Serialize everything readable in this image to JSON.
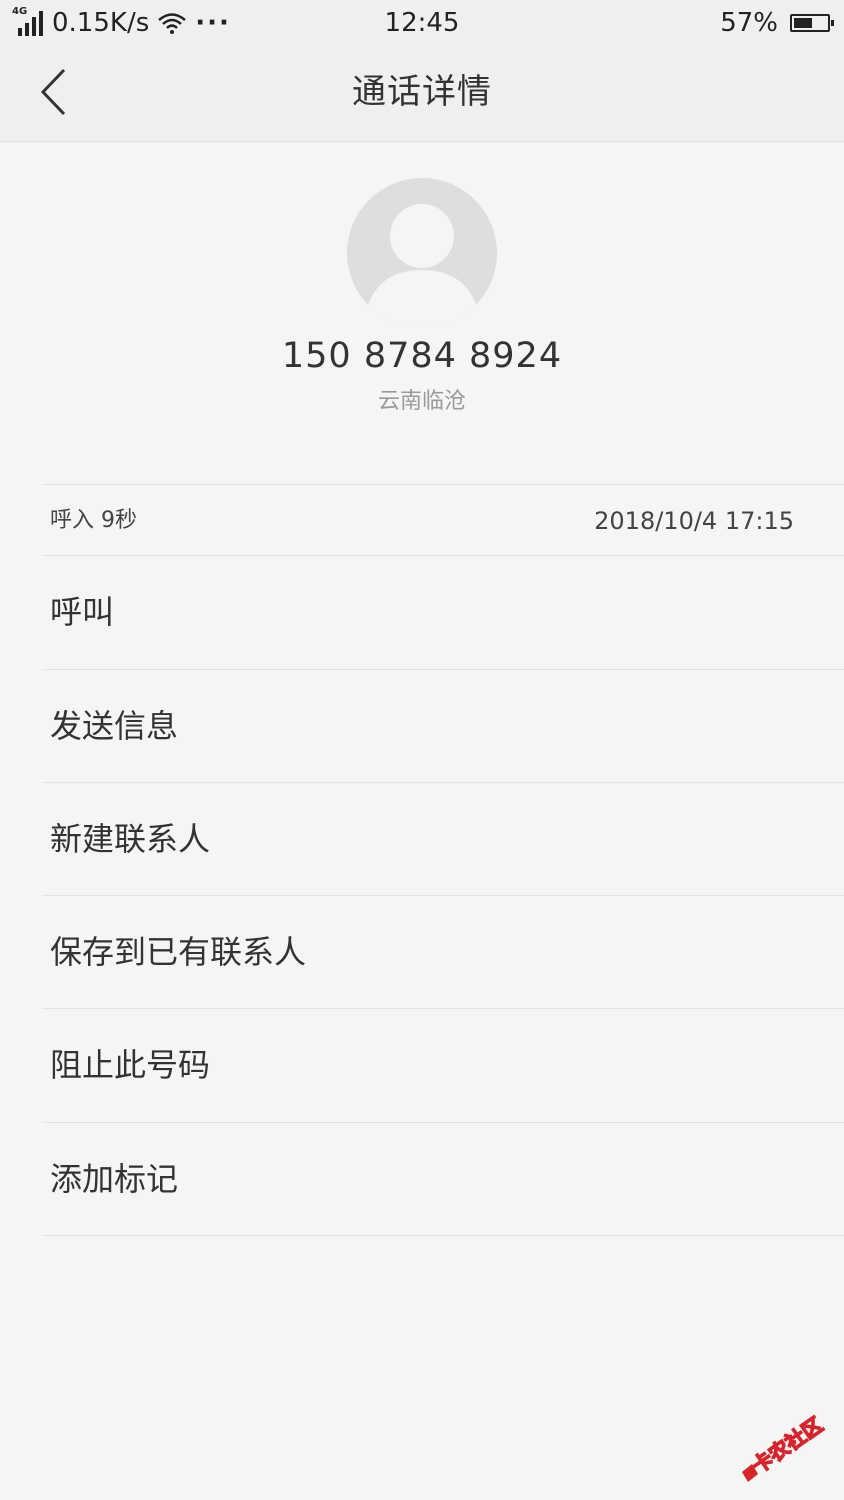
{
  "status_bar": {
    "network_type": "4G",
    "speed": "0.15K/s",
    "more": "···",
    "time": "12:45",
    "battery_percent": "57%",
    "battery_level": 0.57,
    "icons": [
      "signal-icon",
      "wifi-icon",
      "battery-icon"
    ]
  },
  "nav": {
    "title": "通话详情",
    "back_icon": "chevron-left-icon"
  },
  "contact": {
    "avatar_icon": "default-avatar-icon",
    "number": "150 8784 8924",
    "location": "云南临沧"
  },
  "call_log": {
    "type": "呼入  9秒",
    "datetime": "2018/10/4 17:15"
  },
  "actions": [
    {
      "label": "呼叫"
    },
    {
      "label": "发送信息"
    },
    {
      "label": "新建联系人"
    },
    {
      "label": "保存到已有联系人"
    },
    {
      "label": "阻止此号码"
    },
    {
      "label": "添加标记"
    }
  ],
  "watermark": {
    "text": "卡农社区",
    "color": "#d8232a"
  }
}
